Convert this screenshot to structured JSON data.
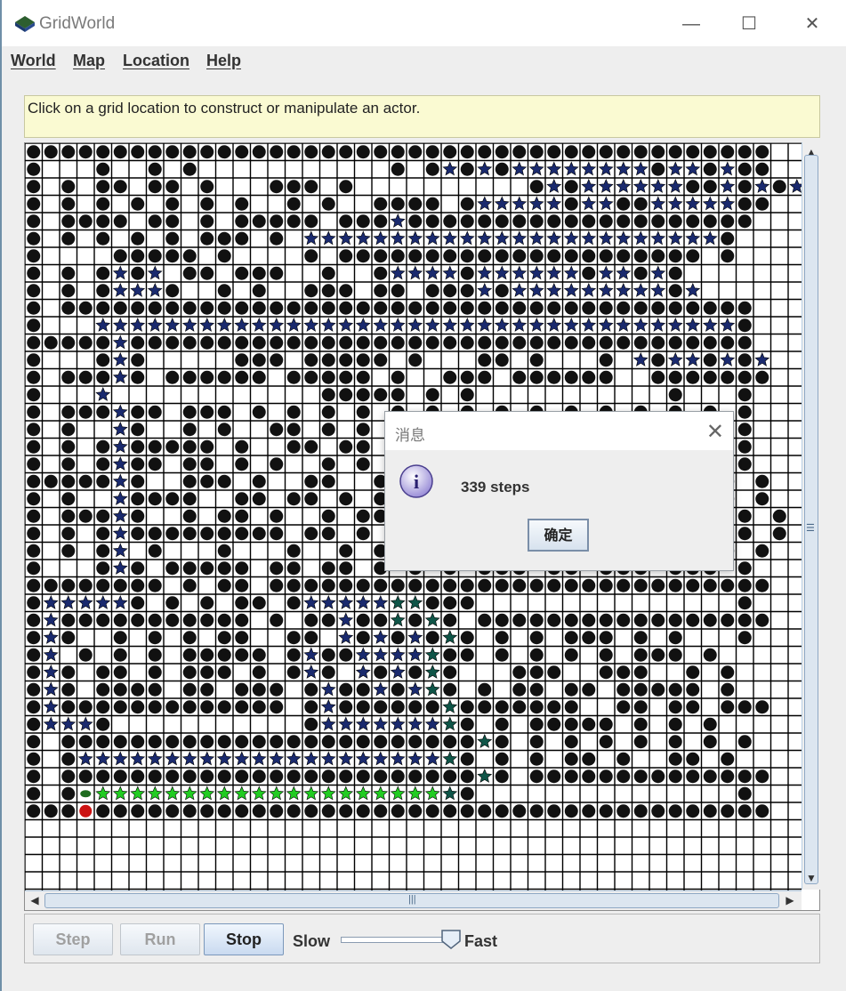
{
  "window": {
    "title": "GridWorld",
    "controls": {
      "minimize": "—",
      "maximize": "☐",
      "close": "✕"
    }
  },
  "menu": [
    "World",
    "Map",
    "Location",
    "Help"
  ],
  "message": "Click on a grid location to construct or manipulate an actor.",
  "grid": {
    "colors": {
      "rock": "#111111",
      "star_blue": "#1a2a6e",
      "star_teal": "#0f5548",
      "star_green": "#22cc22",
      "bug": "#cc1111",
      "line": "#000000"
    },
    "rows": [
      "RRRRRRRRRRRRRRRRRRRRRRRRRRRRRRRRRRRRRRRRRRR...",
      "R...R..R.R...........R.RBRBRBBBBBBBBRBBRBRR...",
      "R.R.RR.RR.R...RRR.R..........RBRBBBBBBRRBRBRBR...",
      "R.R.R.R.R.R.R..R.R..RRRR.RBBBBBRBBRRBBBBBRR...",
      "R.RRRR.RR.R.RRRRR.RRRBRRRRRRRRRRRRRRRRRRRR...",
      "R.R.R.R.R.RRR.R.BBBBBBBBBBBBBBBBBBBBBBBBR...",
      "R....RRRRR.R....R.RRRRRRRRRRRRRRRRRRRRR.R...",
      "R.R.RBRB.RR.RRR..R..RBBBBRBBBBBBRBBRBR...",
      "R.R.RBBBR..R.R..RRR.RR.RRRBRBBBBBBBBBRB...",
      "R.RRRRRRRRRRRRRRRRRRRRRRRRRRRRRRRRRRRRRRRR...",
      "R...BBBBBBBBBBBBBBBBBBBBBBBBBBBBBBBBBBBBBR...",
      "RRRRRBRRRRRRRRRRRRRRRRRRRRRRRRRRRRRRRRRRRR...",
      "R...RBR.....RRR.RRRRR.R...RR.R...R.BRBBRBRB...",
      "R.RRRBR.RRRRRR.RRRRR.R..RRR.RRRRRR..RRRRRRR...",
      "R...B............RRRRR.R.R...........R...R...",
      "R.RRRBRR.RRR.R.R.R.R.R.R.R.R.R.R.R.R.R.R.R...",
      "R.R..BR..R.R..RR.R.R.R.R.R.R.R.R.R.R.R.R.R...",
      "R.R.RBRRRRR.R..RR.RR.R.R.R.R.R.R.R.R.R.R.R...",
      "R.R.RBRR.RR.R.R..R.R.R.R.R.R.R.R.R.R.R.R.R...",
      "RRRRRBR..RRR.R..RR..R.R.R.R.R.R.R.R.R.R.R.R...",
      "R.R..BRRRR..RR.RR.R.R.R.R.R.R.R.R.R.R.R.R.R...",
      "R.RRRBR..R.RR.R..R.RRR.R.R.R.R.R.R.R.R.R.R.R...",
      "R.R.RBRRRRRRRRR.RR.R.R.R.R.R.R.R.R.R.R.R.R.R...",
      "R.R.RB.R...R...R..R.R.R.R.R.R.R.R.R.R.R.R.R...",
      "R...RBR.RRRRR.RR.RR.R.R.R.RRR.RR.RRR.RRR.R...",
      "RRRRRRRR.R.RR.RRRRRRRRRRRRRRRRRRRRRRRRRRRRR...",
      "RBBBBBR.R.R.RR.RBBBBBTTRRR...............R...",
      "RBRRRRRRRRRRR.R.RRBRRTRTR.RRRRRRRRRRRRRRRRR...",
      "RBR..R.R.R.RR..RR.BRBRBRTR.R.R.RRR.R.R...R...",
      "RB.R.R.R.RRRRR.RBRRBBBBTRR.R.R.R.R.RRR.R...",
      "RBR.RR.R.RRR.R.RBR.BRBRTR...RRR..RRR..R.R...",
      "RBR.RRRR.RR.RRR.RBRRBRBTR.R.RR.RR.RRRRR.R...",
      "RBRRRRRRRRRRRRR.RBRRRRRRTRRRRRRR..RR.RR.RRR...",
      "RBBBR...........RBBBBBBBTR.R.RRRRR.R.R.R...",
      "R.RRRRRRRRRRRRRRRRRRRRRRRRTR.R.R.R.R.R.R.R...",
      "R.RBBBBBBBBBBBBBBBBBBBBBTR.R.R.RR.R..RR.R...",
      "R.RRRRRRRRRRRRRRRRRRRRRRRRTR.RRRRRRRRRRRRRR...",
      "R.RWGGGGGGGGGGGGGGGGGGGGTR...............R...",
      "RRRXRRRRRRRRRRRRRRRRRRRRRRRRRRRRRRRRRRRRRRR...",
      "",
      ""
    ]
  },
  "dialog": {
    "title": "消息",
    "message": "339 steps",
    "ok": "确定",
    "close": "✕"
  },
  "controls": {
    "step": "Step",
    "run": "Run",
    "stop": "Stop",
    "slow": "Slow",
    "fast": "Fast",
    "speed_fraction": 0.95
  }
}
